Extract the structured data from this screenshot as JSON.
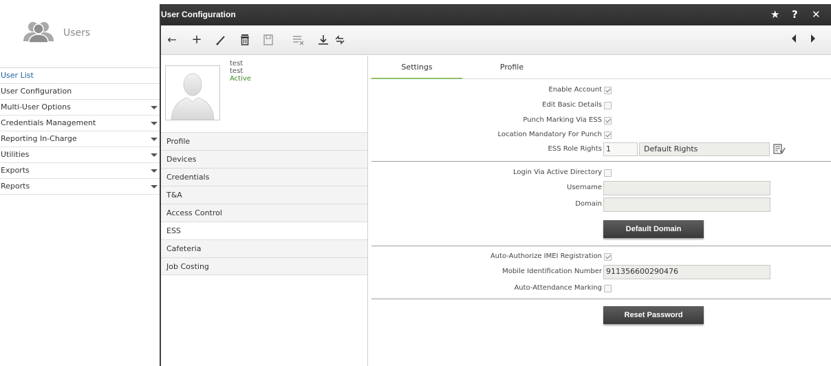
{
  "sidebar": {
    "brand_label": "Users",
    "items": [
      {
        "label": "User List",
        "has_caret": false,
        "style": "link"
      },
      {
        "label": "User Configuration",
        "has_caret": false,
        "style": "normal"
      },
      {
        "label": "Multi-User Options",
        "has_caret": true,
        "style": "normal"
      },
      {
        "label": "Credentials Management",
        "has_caret": true,
        "style": "normal"
      },
      {
        "label": "Reporting In-Charge",
        "has_caret": true,
        "style": "normal"
      },
      {
        "label": "Utilities",
        "has_caret": true,
        "style": "normal"
      },
      {
        "label": "Exports",
        "has_caret": true,
        "style": "normal"
      },
      {
        "label": "Reports",
        "has_caret": true,
        "style": "normal"
      }
    ]
  },
  "window": {
    "title": "User Configuration",
    "favorite_icon": "star-icon",
    "help_label": "?",
    "close_label": "✕"
  },
  "toolbar": {
    "tools": [
      "back-arrow-icon",
      "add-icon",
      "edit-icon",
      "delete-icon",
      "save-icon",
      "clear-icon",
      "download-icon",
      "transfer-icon"
    ],
    "nav": [
      "prev-icon",
      "next-icon"
    ]
  },
  "user": {
    "line1": "test",
    "line2": "test",
    "status": "Active",
    "status_color": "#3c8a26"
  },
  "sections": [
    "Profile",
    "Devices",
    "Credentials",
    "T&A",
    "Access Control",
    "ESS",
    "Cafeteria",
    "Job Costing"
  ],
  "active_section": "ESS",
  "tabs": [
    "Settings",
    "Profile"
  ],
  "active_tab": "Settings",
  "form": {
    "enable_account": {
      "label": "Enable Account",
      "checked": true
    },
    "edit_basic_details": {
      "label": "Edit Basic Details",
      "checked": false
    },
    "punch_marking_via_ess": {
      "label": "Punch Marking Via ESS",
      "checked": true
    },
    "location_mandatory": {
      "label": "Location Mandatory For Punch",
      "checked": true
    },
    "ess_role_rights": {
      "label": "ESS Role Rights",
      "code": "1",
      "name": "Default Rights"
    },
    "login_via_ad": {
      "label": "Login Via Active Directory",
      "checked": false
    },
    "username": {
      "label": "Username",
      "value": ""
    },
    "domain": {
      "label": "Domain",
      "value": ""
    },
    "default_domain_button": "Default Domain",
    "auto_authorize_imei": {
      "label": "Auto-Authorize IMEI Registration",
      "checked": true
    },
    "mobile_id_number": {
      "label": "Mobile Identification Number",
      "value": "911356600290476"
    },
    "auto_attendance": {
      "label": "Auto-Attendance Marking",
      "checked": false
    },
    "reset_password_button": "Reset Password"
  },
  "colors": {
    "titlebar": "#333333",
    "active_tab_underline": "#8dc06e",
    "link": "#1f5f9e"
  }
}
